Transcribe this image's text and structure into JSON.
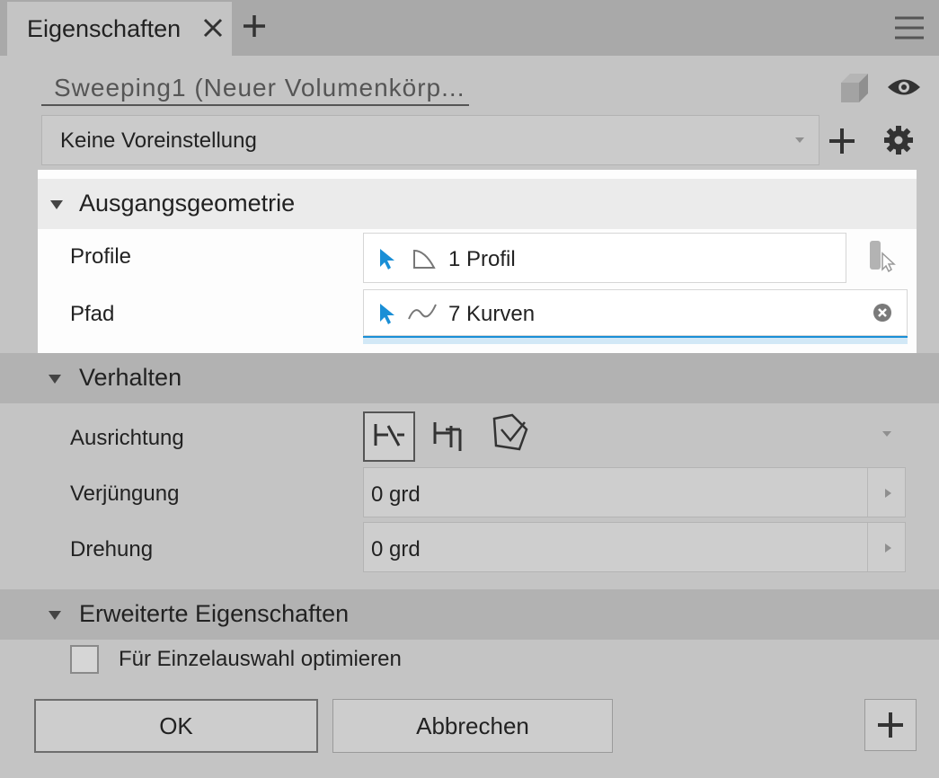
{
  "tabs": [
    {
      "label": "Eigenschaften"
    }
  ],
  "name_field": {
    "value": "Sweeping1 (Neuer Volumenkörp..."
  },
  "preset": {
    "value": "Keine Voreinstellung"
  },
  "sections": {
    "geometry": {
      "title": "Ausgangsgeometrie",
      "rows": [
        {
          "label": "Profile",
          "value": "1 Profil"
        },
        {
          "label": "Pfad",
          "value": "7 Kurven"
        }
      ]
    },
    "behavior": {
      "title": "Verhalten",
      "rows": [
        {
          "label": "Ausrichtung"
        },
        {
          "label": "Verjüngung",
          "value": "0 grd"
        },
        {
          "label": "Drehung",
          "value": "0 grd"
        }
      ]
    },
    "advanced": {
      "title": "Erweiterte Eigenschaften",
      "checkbox_label": "Für Einzelauswahl optimieren",
      "checked": false
    }
  },
  "buttons": {
    "ok": "OK",
    "cancel": "Abbrechen"
  },
  "colors": {
    "accent": "#1a8fd6",
    "highlight": "#fdfdfd",
    "panel": "#c4c4c4"
  }
}
